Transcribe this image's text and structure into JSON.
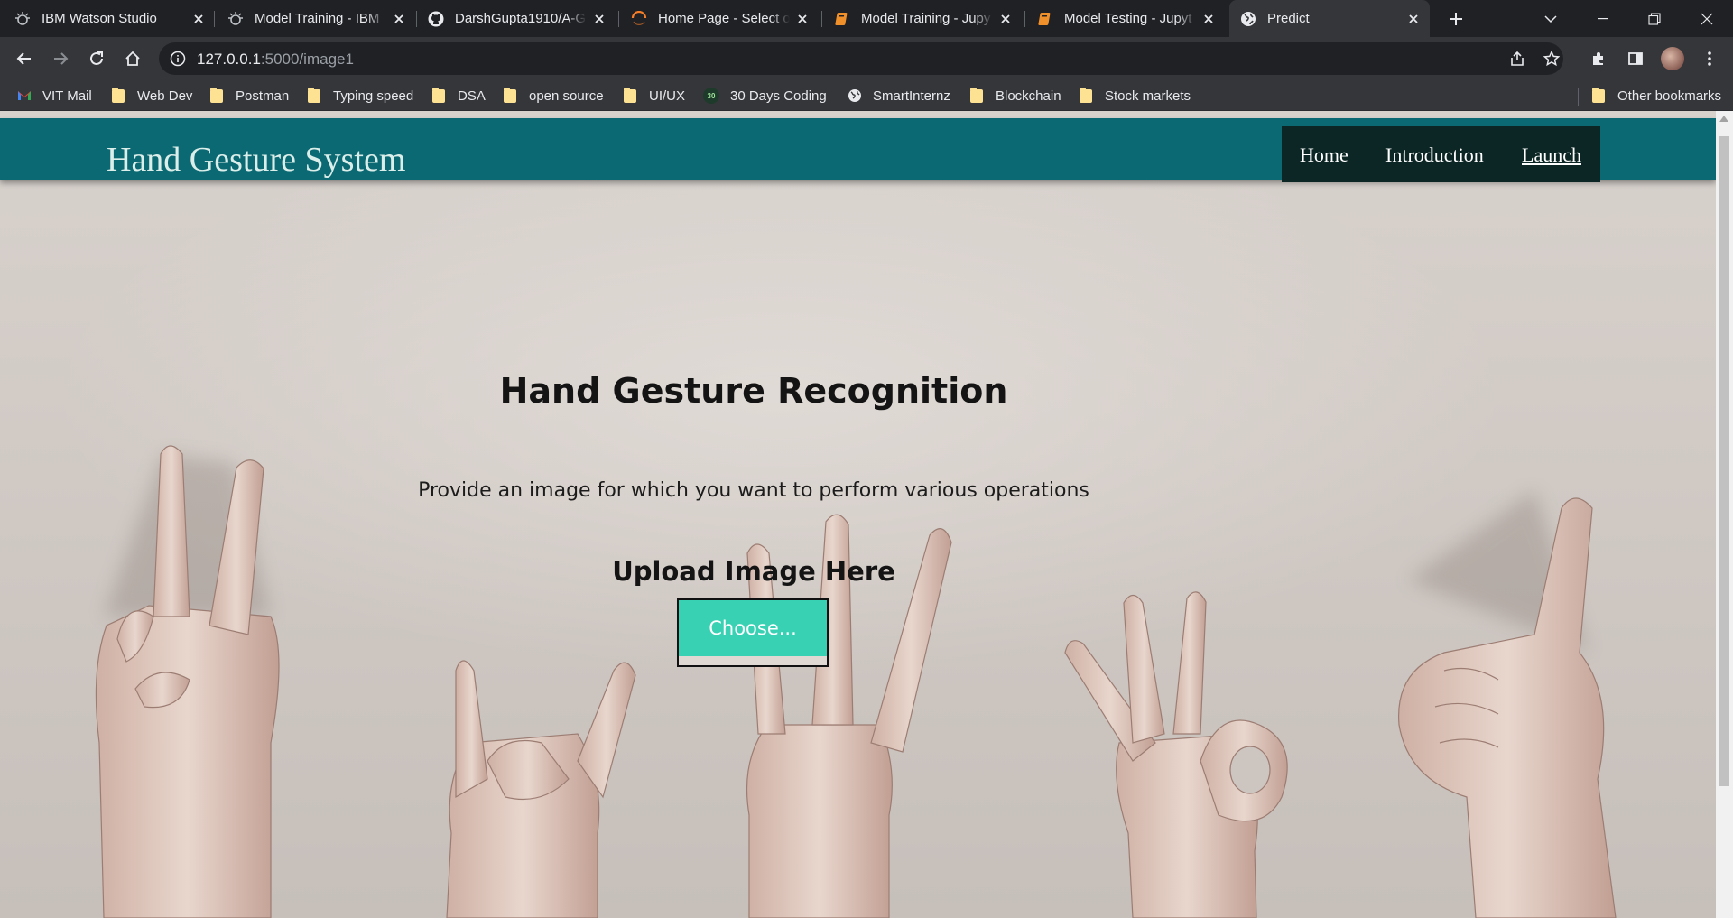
{
  "browser": {
    "tabs": [
      {
        "title": "IBM Watson Studio",
        "icon": "ibm-watson-icon"
      },
      {
        "title": "Model Training - IBM",
        "icon": "ibm-watson-icon"
      },
      {
        "title": "DarshGupta1910/A-G",
        "icon": "github-icon"
      },
      {
        "title": "Home Page - Select o",
        "icon": "loading-spinner-icon"
      },
      {
        "title": "Model Training - Jupy",
        "icon": "jupyter-notebook-icon"
      },
      {
        "title": "Model Testing - Jupyt",
        "icon": "jupyter-notebook-icon"
      },
      {
        "title": "Predict",
        "icon": "globe-icon"
      }
    ],
    "active_tab_index": 6,
    "url_host": "127.0.0.1",
    "url_rest": ":5000/image1",
    "bookmarks": [
      {
        "label": "VIT Mail",
        "icon": "gmail-icon"
      },
      {
        "label": "Web Dev",
        "icon": "folder-icon"
      },
      {
        "label": "Postman",
        "icon": "folder-icon"
      },
      {
        "label": "Typing speed",
        "icon": "folder-icon"
      },
      {
        "label": "DSA",
        "icon": "folder-icon"
      },
      {
        "label": "open source",
        "icon": "folder-icon"
      },
      {
        "label": "UI/UX",
        "icon": "folder-icon"
      },
      {
        "label": "30 Days Coding",
        "icon": "badge-icon",
        "badge": "30"
      },
      {
        "label": "SmartInternz",
        "icon": "globe-icon"
      },
      {
        "label": "Blockchain",
        "icon": "folder-icon"
      },
      {
        "label": "Stock markets",
        "icon": "folder-icon"
      }
    ],
    "other_bookmarks": "Other bookmarks"
  },
  "site": {
    "brand": "Hand Gesture System",
    "nav": [
      {
        "label": "Home",
        "current": false
      },
      {
        "label": "Introduction",
        "current": false
      },
      {
        "label": "Launch",
        "current": true
      }
    ]
  },
  "main": {
    "title": "Hand Gesture Recognition",
    "subtitle": "Provide an image for which you want to perform various operations",
    "upload_label": "Upload Image Here",
    "choose_button": "Choose..."
  },
  "colors": {
    "header_bg": "#0b6973",
    "nav_bg": "#0b2624",
    "button_accent": "#38d1b3",
    "chrome_dark": "#202124",
    "chrome_toolbar": "#35363a"
  }
}
